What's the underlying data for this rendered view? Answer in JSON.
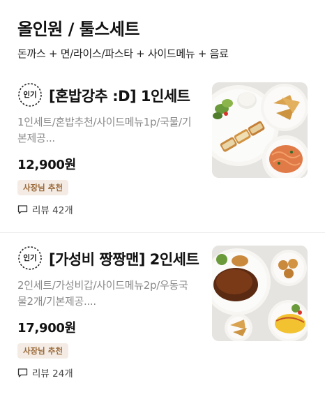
{
  "section": {
    "title": "올인원 / 툴스세트",
    "subtitle": "돈까스 + 면/라이스/파스타 + 사이드메뉴 + 음료"
  },
  "items": [
    {
      "badge": "인기",
      "name": "[혼밥강추 :D] 1인세트",
      "desc_line1": "1인세트/혼밥추천/사이드메뉴1p/국물/기",
      "desc_line2": "본제공...",
      "price": "12,900원",
      "tag": "사장님 추천",
      "reviews": "리뷰 42개"
    },
    {
      "badge": "인기",
      "name": "[가성비 짱짱맨] 2인세트",
      "desc_line1": "2인세트/가성비갑/사이드메뉴2p/우동국",
      "desc_line2": "물2개/기본제공....",
      "price": "17,900원",
      "tag": "사장님 추천",
      "reviews": "리뷰 24개"
    }
  ],
  "colors": {
    "tag_text": "#9a6a3a",
    "tag_bg": "#f4ece4",
    "desc": "#8a8a8a"
  }
}
